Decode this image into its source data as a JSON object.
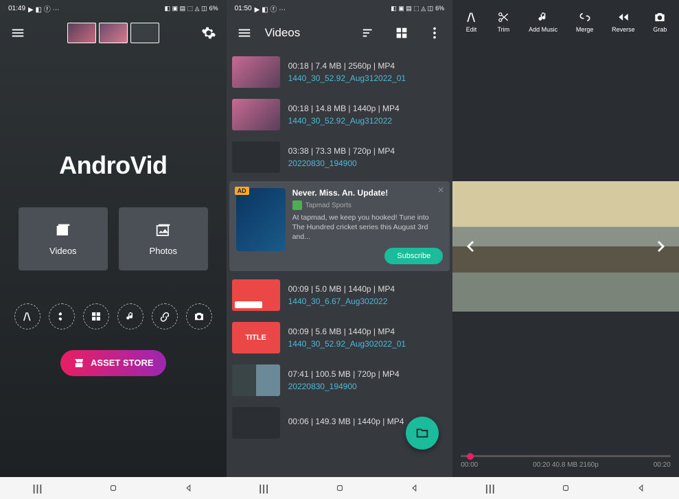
{
  "status": {
    "time1": "01:49",
    "time2": "01:50",
    "battery": "6%",
    "sigicons": "◧ ▣ ▤ ⬚ ◬ ◫"
  },
  "screen1": {
    "brand": "AndroVid",
    "videos": "Videos",
    "photos": "Photos",
    "assetstore": "ASSET STORE"
  },
  "screen2": {
    "title": "Videos",
    "items": [
      {
        "meta": "00:18 | 7.4 MB | 2560p | MP4",
        "name": "1440_30_52.92_Aug312022_01",
        "cls": "vt-pink"
      },
      {
        "meta": "00:18 | 14.8 MB | 1440p | MP4",
        "name": "1440_30_52.92_Aug312022",
        "cls": "vt-pink"
      },
      {
        "meta": "03:38 | 73.3 MB | 720p | MP4",
        "name": "20220830_194900",
        "cls": "vt-grid"
      },
      {
        "meta": "00:09 | 5.0 MB | 1440p | MP4",
        "name": "1440_30_6.67_Aug302022",
        "cls": "vt-red"
      },
      {
        "meta": "00:09 | 5.6 MB | 1440p | MP4",
        "name": "1440_30_52.92_Aug302022_01",
        "cls": "vt-title"
      },
      {
        "meta": "07:41 | 100.5 MB | 720p | MP4",
        "name": "20220830_194900",
        "cls": "vt-multi"
      },
      {
        "meta": "00:06 | 149.3 MB | 1440p | MP4",
        "name": "",
        "cls": "vt-grid"
      }
    ],
    "ad": {
      "badge": "AD",
      "title": "Never. Miss. An. Update!",
      "publisher": "Tapmad Sports",
      "desc": "At tapmad, we keep you hooked! Tune into The Hundred cricket series this August 3rd and...",
      "button": "Subscribe"
    },
    "titlelabel": "TITLE"
  },
  "screen3": {
    "tools": [
      {
        "label": "Edit",
        "icon": "edit"
      },
      {
        "label": "Trim",
        "icon": "trim"
      },
      {
        "label": "Add Music",
        "icon": "music"
      },
      {
        "label": "Merge",
        "icon": "merge"
      },
      {
        "label": "Reverse",
        "icon": "reverse"
      },
      {
        "label": "Grab",
        "icon": "grab"
      }
    ],
    "time": {
      "start": "00:00",
      "mid": "00:20  40.8 MB  2160p",
      "end": "00:20"
    }
  }
}
